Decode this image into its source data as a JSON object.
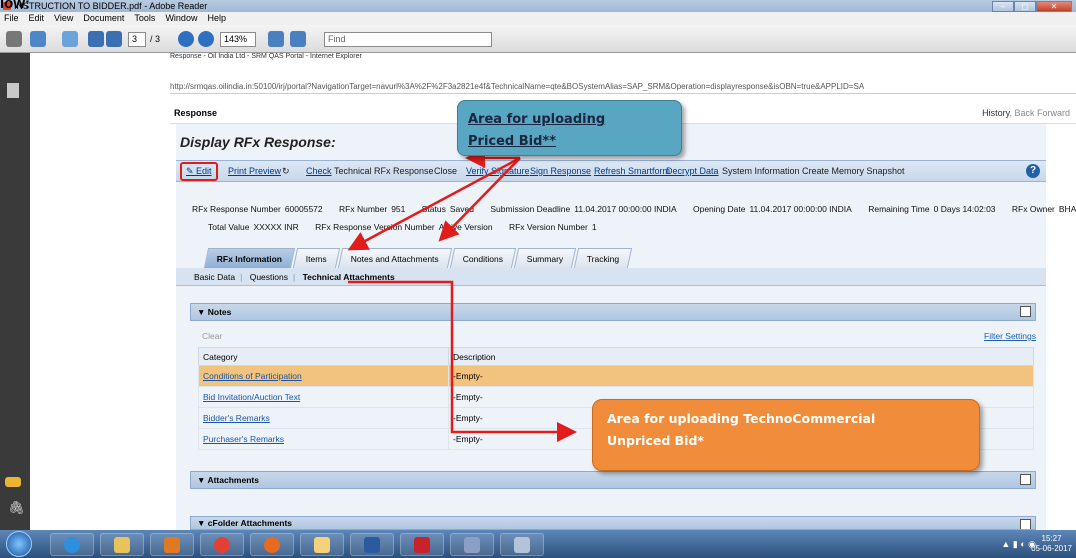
{
  "partial_heading": "low:",
  "window": {
    "title": "INSTRUCTION TO BIDDER.pdf - Adobe Reader",
    "controls": [
      "minimize",
      "maximize",
      "close"
    ]
  },
  "menu": [
    "File",
    "Edit",
    "View",
    "Document",
    "Tools",
    "Window",
    "Help"
  ],
  "toolbar": {
    "page_current": "3",
    "page_total": "/ 3",
    "zoom": "143%",
    "find_placeholder": "Find"
  },
  "browser": {
    "title": "Response - Oil India Ltd - SRM QAS Portal - Internet Explorer",
    "address": "http://srmqas.oilindia.in:50100/irj/portal?NavigationTarget=navurl%3A%2F%2F3a2821e4f&TechnicalName=qte&BOSystemAlias=SAP_SRM&Operation=displayresponse&isOBN=true&APPLID=SA",
    "response_label": "Response",
    "nav_history": "History",
    "nav_back": "Back",
    "nav_forward": "Forward"
  },
  "portal": {
    "title": "Display RFx Response:",
    "actions": {
      "edit": "Edit",
      "print_preview": "Print Preview",
      "refresh_icon": "↻",
      "check": "Check",
      "technical_rfx_response": "Technical RFx Response",
      "close": "Close",
      "verify_signature": "Verify Signature",
      "sign_response": "Sign Response",
      "refresh_smartform": "Refresh Smartform",
      "decrypt_data": "Decrypt Data",
      "system_information": "System Information",
      "create_memory_snapshot": "Create Memory Snapshot"
    },
    "info": {
      "rfx_response_number_label": "RFx Response Number",
      "rfx_response_number": "60005572",
      "rfx_number_label": "RFx Number",
      "rfx_number": "951",
      "status_label": "Status",
      "status": "Saved",
      "submission_deadline_label": "Submission Deadline",
      "submission_deadline": "11.04.2017 00:00:00 INDIA",
      "opening_date_label": "Opening Date",
      "opening_date": "11.04.2017 00:00:00 INDIA",
      "remaining_time_label": "Remaining Time",
      "remaining_time": "0 Days 14:02:03",
      "rfx_owner_label": "RFx Owner",
      "rfx_owner": "BHARALI",
      "total_value_label": "Total Value",
      "total_value": "XXXXX INR",
      "rfx_response_version_label": "RFx Response Version Number",
      "rfx_response_version": "Active Version",
      "rfx_version_label": "RFx Version Number",
      "rfx_version": "1"
    },
    "tabs": [
      "RFx Information",
      "Items",
      "Notes and Attachments",
      "Conditions",
      "Summary",
      "Tracking"
    ],
    "subtabs": [
      "Basic Data",
      "Questions",
      "Technical Attachments"
    ],
    "sections": {
      "notes": "▼ Notes",
      "attachments": "▼ Attachments",
      "cfolder": "▼ cFolder Attachments"
    },
    "clear": "Clear",
    "filter": "Filter",
    "settings": "Settings",
    "notes_table": {
      "headers": [
        "Category",
        "Description"
      ],
      "rows": [
        [
          "Conditions of Participation",
          "-Empty-"
        ],
        [
          "Bid Invitation/Auction Text",
          "-Empty-"
        ],
        [
          "Bidder's Remarks",
          "-Empty-"
        ],
        [
          "Purchaser's Remarks",
          "-Empty-"
        ]
      ]
    }
  },
  "callouts": {
    "priced_line1": "Area for uploading",
    "priced_line2": "Priced Bid**",
    "unpriced_line1": "Area for uploading TechnoCommercial",
    "unpriced_line2": "Unpriced Bid*"
  },
  "taskbar": {
    "clock_time": "15:27",
    "clock_date": "05-06-2017"
  },
  "colors": {
    "annotation_red": "#e21b1b",
    "priced_callout": "#58a6c1",
    "unpriced_callout": "#f08c3a",
    "highlight_row": "#f1c37e"
  }
}
